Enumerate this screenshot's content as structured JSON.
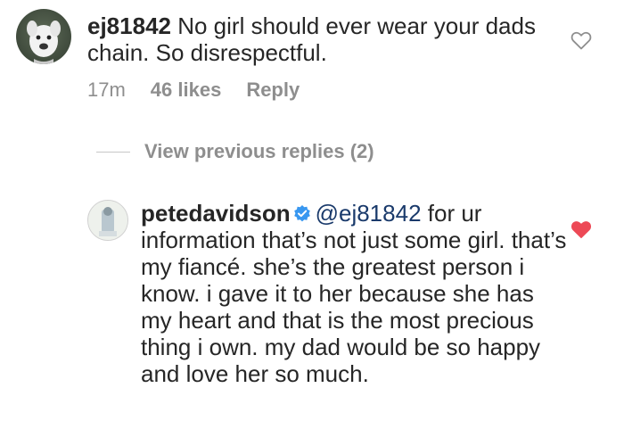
{
  "comment1": {
    "username": "ej81842",
    "text": "No girl should ever wear your dads chain. So disrespectful.",
    "time": "17m",
    "likes": "46 likes",
    "reply_label": "Reply"
  },
  "view_replies": {
    "label": "View previous replies (2)"
  },
  "comment2": {
    "username": "petedavidson",
    "mention": "@ej81842",
    "text": "for ur information that’s not just some girl. that’s my fiancé. she’s the greatest person i know. i gave it to her because she has my heart and that is the most precious thing i own. my dad would be so happy and love her so much."
  },
  "colors": {
    "text": "#262626",
    "muted": "#8e8e8e",
    "mention": "#1a3a6b",
    "liked_heart": "#ed4956",
    "verified_badge": "#3897f0"
  },
  "icons": {
    "heart_outline": "heart-outline-icon",
    "heart_filled": "heart-filled-icon",
    "verified": "verified-badge-icon"
  }
}
